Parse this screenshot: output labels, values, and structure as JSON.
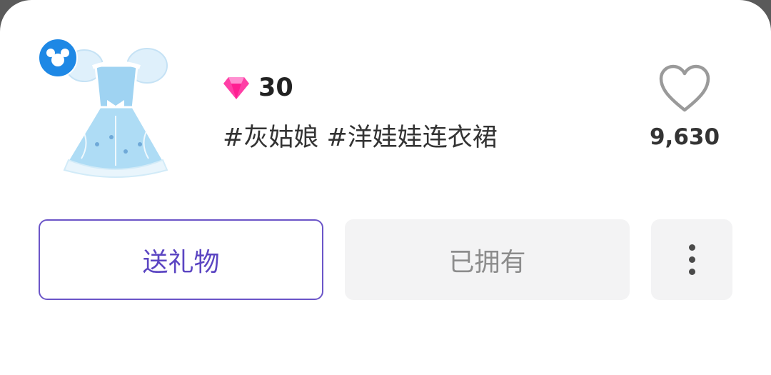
{
  "item": {
    "image_name": "cinderella-doll-dress-image",
    "badge_icon": "mickey-ears-icon",
    "currency_icon": "pink-diamond-icon",
    "price": "30",
    "tags": "#灰姑娘 #洋娃娃连衣裙"
  },
  "like": {
    "icon": "heart-outline-icon",
    "count": "9,630"
  },
  "actions": {
    "gift_label": "送礼物",
    "owned_label": "已拥有",
    "more_icon": "vertical-ellipsis-icon"
  },
  "colors": {
    "accent": "#6b55c8",
    "gem": "#ff3fa6",
    "badge": "#1e88e5",
    "button_bg": "#f3f3f4"
  }
}
